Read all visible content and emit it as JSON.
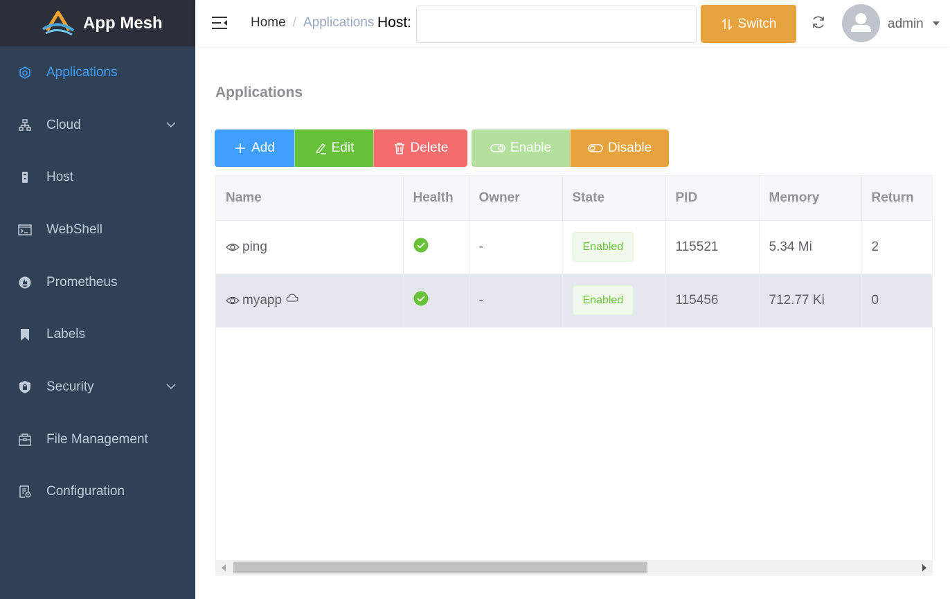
{
  "app": {
    "title": "App Mesh"
  },
  "sidebar": {
    "items": [
      {
        "label": "Applications",
        "icon": "applications-icon",
        "active": true
      },
      {
        "label": "Cloud",
        "icon": "cloud-network-icon",
        "has_children": true
      },
      {
        "label": "Host",
        "icon": "host-icon"
      },
      {
        "label": "WebShell",
        "icon": "terminal-icon"
      },
      {
        "label": "Prometheus",
        "icon": "prometheus-icon"
      },
      {
        "label": "Labels",
        "icon": "bookmark-icon"
      },
      {
        "label": "Security",
        "icon": "shield-icon",
        "has_children": true
      },
      {
        "label": "File Management",
        "icon": "file-management-icon"
      },
      {
        "label": "Configuration",
        "icon": "configuration-icon"
      }
    ]
  },
  "header": {
    "breadcrumb": {
      "home": "Home",
      "separator": "/",
      "current": "Applications"
    },
    "host_label": "Host:",
    "host_input": {
      "value": "",
      "placeholder": ""
    },
    "switch_label": "Switch",
    "user": {
      "name": "admin"
    }
  },
  "main": {
    "title": "Applications",
    "toolbar": {
      "add": "Add",
      "edit": "Edit",
      "delete": "Delete",
      "enable": "Enable",
      "disable": "Disable"
    },
    "table": {
      "columns": [
        "Name",
        "Health",
        "Owner",
        "State",
        "PID",
        "Memory",
        "Return"
      ],
      "rows": [
        {
          "name": "ping",
          "health": "healthy",
          "owner": "-",
          "state": "Enabled",
          "pid": "115521",
          "memory": "5.34 Mi",
          "return": "2",
          "cloud": false
        },
        {
          "name": "myapp",
          "health": "healthy",
          "owner": "-",
          "state": "Enabled",
          "pid": "115456",
          "memory": "712.77 Ki",
          "return": "0",
          "cloud": true
        }
      ]
    }
  },
  "colors": {
    "sidebar_bg": "#304156",
    "logo_bg": "#2b2f3a",
    "accent": "#409eff",
    "success": "#67c23a",
    "danger": "#f56c6c",
    "warning": "#e6a23c"
  }
}
